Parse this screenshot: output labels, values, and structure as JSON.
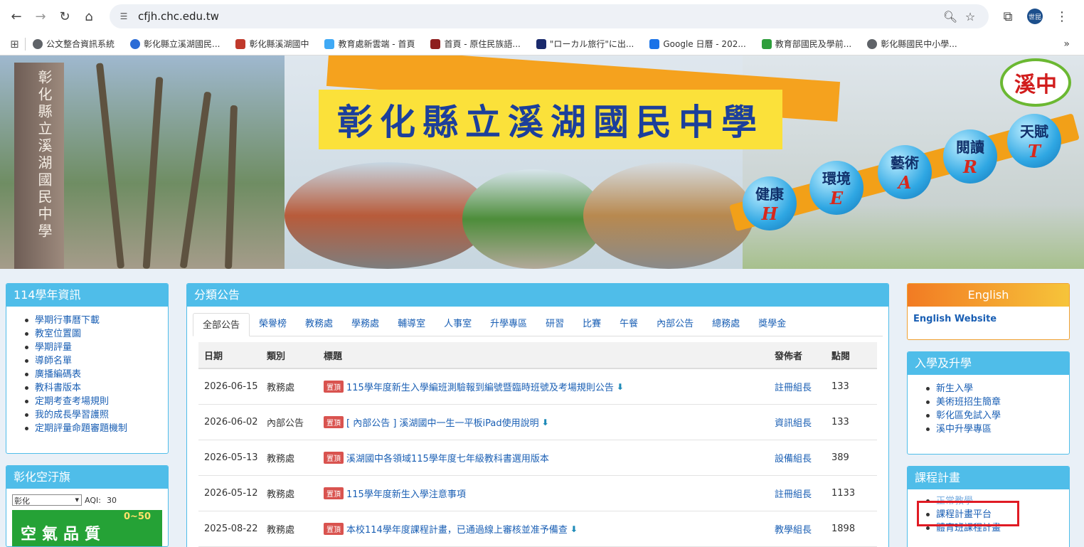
{
  "browser": {
    "url": "cfjh.chc.edu.tw",
    "profile_label": "世昆",
    "bookmarks": [
      {
        "label": "公文整合資訊系統",
        "color": "#5f6368"
      },
      {
        "label": "彰化縣立溪湖國民...",
        "color": "#2b6cd6"
      },
      {
        "label": "彰化縣溪湖國中",
        "color": "#c0392b"
      },
      {
        "label": "教育處新雲端 - 首頁",
        "color": "#3fa9f5"
      },
      {
        "label": "首頁 - 原住民族語...",
        "color": "#8e1e1e"
      },
      {
        "label": "\"ローカル旅行\"に出...",
        "color": "#1a2a6c"
      },
      {
        "label": "Google 日曆 - 202...",
        "color": "#1a73e8"
      },
      {
        "label": "教育部國民及學前...",
        "color": "#2e9e3b"
      },
      {
        "label": "彰化縣國民中小學...",
        "color": "#5f6368"
      }
    ]
  },
  "banner": {
    "title": "彰化縣立溪湖國民中學",
    "pillar_text": "彰化縣立溪湖國民中學",
    "logo_text": "溪中",
    "bubbles": [
      {
        "zh": "健康",
        "en": "H"
      },
      {
        "zh": "環境",
        "en": "E"
      },
      {
        "zh": "藝術",
        "en": "A"
      },
      {
        "zh": "閱讀",
        "en": "R"
      },
      {
        "zh": "天賦",
        "en": "T"
      }
    ]
  },
  "left": {
    "info_title": "114學年資訊",
    "info_items": [
      "學期行事曆下載",
      "教室位置圖",
      "學期評量",
      "導師名單",
      "廣播編碼表",
      "教科書版本",
      "定期考查考場規則",
      "我的成長學習護照",
      "定期評量命題審題機制"
    ],
    "aqi_title": "彰化空汙旗",
    "aqi_select": "彰化",
    "aqi_label": "AQI:",
    "aqi_value": "30",
    "aqi_quality": "空氣品質",
    "aqi_range": "0~50"
  },
  "notices": {
    "title": "分類公告",
    "tabs": [
      "全部公告",
      "榮譽榜",
      "教務處",
      "學務處",
      "輔導室",
      "人事室",
      "升學專區",
      "研習",
      "比賽",
      "午餐",
      "內部公告",
      "總務處",
      "獎學金"
    ],
    "headers": {
      "date": "日期",
      "category": "類別",
      "title": "標題",
      "publisher": "發佈者",
      "hits": "點閱"
    },
    "top_tag": "置頂",
    "rows": [
      {
        "date": "2026-06-15",
        "category": "教務處",
        "title": "115學年度新生入學編班測驗報到編號暨臨時班號及考場規則公告",
        "publisher": "註冊組長",
        "hits": "133",
        "download": true
      },
      {
        "date": "2026-06-02",
        "category": "內部公告",
        "title": "[ 內部公告 ] 溪湖國中一生一平板iPad使用說明",
        "publisher": "資訊組長",
        "hits": "133",
        "download": true
      },
      {
        "date": "2026-05-13",
        "category": "教務處",
        "title": "溪湖國中各領域115學年度七年級教科書選用版本",
        "publisher": "設備組長",
        "hits": "389",
        "download": false
      },
      {
        "date": "2026-05-12",
        "category": "教務處",
        "title": "115學年度新生入學注意事項",
        "publisher": "註冊組長",
        "hits": "1133",
        "download": false
      },
      {
        "date": "2025-08-22",
        "category": "教務處",
        "title": "本校114學年度課程計畫，已通過線上審核並准予備查",
        "publisher": "教學組長",
        "hits": "1898",
        "download": true
      }
    ]
  },
  "right": {
    "english_title": "English",
    "english_link": "English Website",
    "admission_title": "入學及升學",
    "admission_items": [
      "新生入學",
      "美術班招生簡章",
      "彰化區免試入學",
      "溪中升學專區"
    ],
    "curriculum_title": "課程計畫",
    "curriculum_items": [
      "正常教學",
      "課程計畫平台",
      "體育班課程計畫"
    ]
  }
}
